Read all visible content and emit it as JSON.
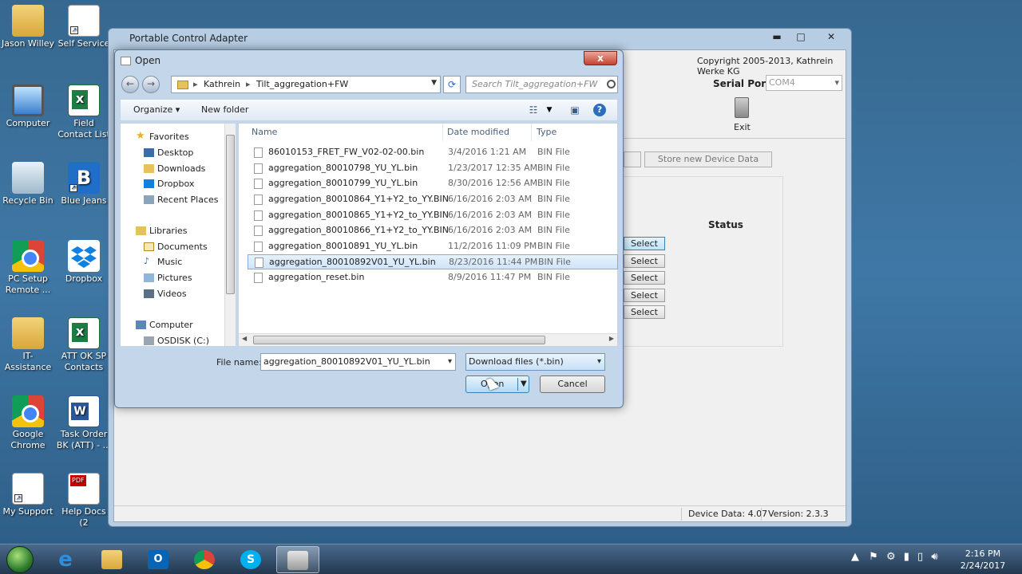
{
  "desktop": {
    "icons": [
      {
        "label": "Jason Willey",
        "icon": "user-folder-icon"
      },
      {
        "label": "Self Service",
        "icon": "self-service-icon"
      },
      {
        "label": "Computer",
        "icon": "computer-icon"
      },
      {
        "label": "Field Contact List",
        "icon": "excel-icon"
      },
      {
        "label": "Recycle Bin",
        "icon": "recycle-bin-icon"
      },
      {
        "label": "Blue Jeans",
        "icon": "bluejeans-icon"
      },
      {
        "label": "PC Setup Remote ...",
        "icon": "chrome-icon"
      },
      {
        "label": "Dropbox",
        "icon": "dropbox-icon"
      },
      {
        "label": "IT-Assistance",
        "icon": "folder-icon"
      },
      {
        "label": "ATT OK SP Contacts",
        "icon": "excel-icon"
      },
      {
        "label": "Google Chrome",
        "icon": "chrome-icon"
      },
      {
        "label": "Task Order BK (ATT) - ...",
        "icon": "word-icon"
      },
      {
        "label": "My Support",
        "icon": "support-icon"
      },
      {
        "label": "Help Docs (2",
        "icon": "pdf-icon"
      }
    ]
  },
  "app": {
    "title": "Portable Control Adapter",
    "copyright": "Copyright  2005-2013, Kathrein Werke KG",
    "serial_port_label": "Serial Port:",
    "serial_port_value": "COM4",
    "exit_label": "Exit",
    "store_button": "Store new Device Data",
    "status_label": "Status",
    "select_label": "Select",
    "device_data": "Device Data: 4.07",
    "version": "Version: 2.3.3"
  },
  "dialog": {
    "title": "Open",
    "close": "x",
    "breadcrumb": [
      "Kathrein",
      "Tilt_aggregation+FW"
    ],
    "search_placeholder": "Search Tilt_aggregation+FW",
    "organize": "Organize",
    "new_folder": "New folder",
    "nav": {
      "favorites": "Favorites",
      "desktop": "Desktop",
      "downloads": "Downloads",
      "dropbox": "Dropbox",
      "recent": "Recent Places",
      "libraries": "Libraries",
      "documents": "Documents",
      "music": "Music",
      "pictures": "Pictures",
      "videos": "Videos",
      "computer": "Computer",
      "osdisk": "OSDISK (C:)"
    },
    "columns": {
      "name": "Name",
      "date": "Date modified",
      "type": "Type"
    },
    "files": [
      {
        "name": "86010153_FRET_FW_V02-02-00.bin",
        "date": "3/4/2016 1:21 AM",
        "type": "BIN File"
      },
      {
        "name": "aggregation_80010798_YU_YL.bin",
        "date": "1/23/2017 12:35 AM",
        "type": "BIN File"
      },
      {
        "name": "aggregation_80010799_YU_YL.bin",
        "date": "8/30/2016 12:56 AM",
        "type": "BIN File"
      },
      {
        "name": "aggregation_80010864_Y1+Y2_to_YY.BIN",
        "date": "6/16/2016 2:03 AM",
        "type": "BIN File"
      },
      {
        "name": "aggregation_80010865_Y1+Y2_to_YY.BIN",
        "date": "6/16/2016 2:03 AM",
        "type": "BIN File"
      },
      {
        "name": "aggregation_80010866_Y1+Y2_to_YY.BIN",
        "date": "6/16/2016 2:03 AM",
        "type": "BIN File"
      },
      {
        "name": "aggregation_80010891_YU_YL.bin",
        "date": "11/2/2016 11:09 PM",
        "type": "BIN File"
      },
      {
        "name": "aggregation_80010892V01_YU_YL.bin",
        "date": "8/23/2016 11:44 PM",
        "type": "BIN File"
      },
      {
        "name": "aggregation_reset.bin",
        "date": "8/9/2016 11:47 PM",
        "type": "BIN File"
      }
    ],
    "file_name_label": "File name:",
    "file_name_value": "aggregation_80010892V01_YU_YL.bin",
    "file_type": "Download files (*.bin)",
    "open_button": "Open",
    "cancel_button": "Cancel"
  },
  "taskbar": {
    "time": "2:16 PM",
    "date": "2/24/2017"
  }
}
